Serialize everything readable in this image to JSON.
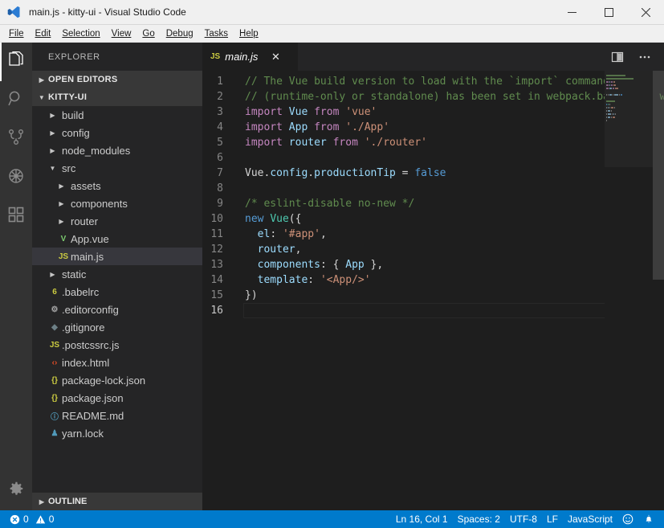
{
  "window": {
    "title": "main.js - kitty-ui - Visual Studio Code",
    "app_icon": "vscode-logo-icon",
    "controls": {
      "minimize": "minimize-icon",
      "maximize": "maximize-icon",
      "close": "close-icon"
    }
  },
  "menubar": {
    "items": [
      {
        "label": "File"
      },
      {
        "label": "Edit"
      },
      {
        "label": "Selection"
      },
      {
        "label": "View"
      },
      {
        "label": "Go"
      },
      {
        "label": "Debug"
      },
      {
        "label": "Tasks"
      },
      {
        "label": "Help"
      }
    ]
  },
  "activitybar": {
    "items": [
      {
        "name": "explorer",
        "icon": "files-icon",
        "active": true
      },
      {
        "name": "search",
        "icon": "search-icon",
        "active": false
      },
      {
        "name": "source-control",
        "icon": "source-control-icon",
        "active": false
      },
      {
        "name": "debug",
        "icon": "debug-icon",
        "active": false
      },
      {
        "name": "extensions",
        "icon": "extensions-icon",
        "active": false
      }
    ],
    "bottom": {
      "name": "manage",
      "icon": "gear-icon"
    }
  },
  "sidebar": {
    "header": "EXPLORER",
    "open_editors": {
      "label": "OPEN EDITORS",
      "expanded": false
    },
    "project": {
      "label": "KITTY-UI",
      "expanded": true
    },
    "tree": [
      {
        "label": "build",
        "depth": 1,
        "type": "folder",
        "expanded": false,
        "icon": "folder-icon",
        "color": "#c5c5c5"
      },
      {
        "label": "config",
        "depth": 1,
        "type": "folder",
        "expanded": false,
        "icon": "folder-icon",
        "color": "#c5c5c5"
      },
      {
        "label": "node_modules",
        "depth": 1,
        "type": "folder",
        "expanded": false,
        "icon": "folder-icon",
        "color": "#c5c5c5"
      },
      {
        "label": "src",
        "depth": 1,
        "type": "folder",
        "expanded": true,
        "icon": "folder-icon",
        "color": "#c5c5c5"
      },
      {
        "label": "assets",
        "depth": 2,
        "type": "folder",
        "expanded": false,
        "icon": "folder-icon",
        "color": "#c5c5c5"
      },
      {
        "label": "components",
        "depth": 2,
        "type": "folder",
        "expanded": false,
        "icon": "folder-icon",
        "color": "#c5c5c5"
      },
      {
        "label": "router",
        "depth": 2,
        "type": "folder",
        "expanded": false,
        "icon": "folder-icon",
        "color": "#c5c5c5"
      },
      {
        "label": "App.vue",
        "depth": 2,
        "type": "file",
        "icon": "vue-icon",
        "glyph": "V",
        "color": "#7bc96f"
      },
      {
        "label": "main.js",
        "depth": 2,
        "type": "file",
        "icon": "js-icon",
        "glyph": "JS",
        "color": "#cbcb41",
        "selected": true
      },
      {
        "label": "static",
        "depth": 1,
        "type": "folder",
        "expanded": false,
        "icon": "folder-icon",
        "color": "#c5c5c5"
      },
      {
        "label": ".babelrc",
        "depth": 1,
        "type": "file",
        "icon": "babel-icon",
        "glyph": "6",
        "color": "#cbcb41"
      },
      {
        "label": ".editorconfig",
        "depth": 1,
        "type": "file",
        "icon": "gear-icon",
        "glyph": "⚙",
        "color": "#a8a8a8"
      },
      {
        "label": ".gitignore",
        "depth": 1,
        "type": "file",
        "icon": "git-icon",
        "glyph": "◆",
        "color": "#6d8086"
      },
      {
        "label": ".postcssrc.js",
        "depth": 1,
        "type": "file",
        "icon": "js-icon",
        "glyph": "JS",
        "color": "#cbcb41"
      },
      {
        "label": "index.html",
        "depth": 1,
        "type": "file",
        "icon": "html-icon",
        "glyph": "‹›",
        "color": "#e44d26"
      },
      {
        "label": "package-lock.json",
        "depth": 1,
        "type": "file",
        "icon": "json-icon",
        "glyph": "{}",
        "color": "#cbcb41"
      },
      {
        "label": "package.json",
        "depth": 1,
        "type": "file",
        "icon": "json-icon",
        "glyph": "{}",
        "color": "#cbcb41"
      },
      {
        "label": "README.md",
        "depth": 1,
        "type": "file",
        "icon": "markdown-icon",
        "glyph": "ⓘ",
        "color": "#519aba"
      },
      {
        "label": "yarn.lock",
        "depth": 1,
        "type": "file",
        "icon": "yarn-icon",
        "glyph": "♟",
        "color": "#519aba"
      }
    ],
    "outline": {
      "label": "OUTLINE",
      "expanded": false
    }
  },
  "editor": {
    "tab": {
      "label": "main.js",
      "icon": "js-icon",
      "icon_glyph": "JS",
      "close_icon": "close-icon",
      "italic": true
    },
    "actions": [
      {
        "name": "split-editor",
        "icon": "split-editor-icon"
      },
      {
        "name": "more-actions",
        "icon": "ellipsis-icon"
      }
    ],
    "line_count": 16,
    "active_line": 16,
    "lines": [
      {
        "n": 1,
        "tokens": [
          {
            "t": "// The Vue build version to load with the `import` command",
            "c": "comment"
          }
        ]
      },
      {
        "n": 2,
        "tokens": [
          {
            "t": "// (runtime-only or standalone) has been set in webpack.base.conf with an alias.",
            "c": "comment"
          }
        ]
      },
      {
        "n": 3,
        "tokens": [
          {
            "t": "import ",
            "c": "kw"
          },
          {
            "t": "Vue",
            "c": "var"
          },
          {
            "t": " from ",
            "c": "kw"
          },
          {
            "t": "'vue'",
            "c": "str"
          }
        ]
      },
      {
        "n": 4,
        "tokens": [
          {
            "t": "import ",
            "c": "kw"
          },
          {
            "t": "App",
            "c": "var"
          },
          {
            "t": " from ",
            "c": "kw"
          },
          {
            "t": "'./App'",
            "c": "str"
          }
        ]
      },
      {
        "n": 5,
        "tokens": [
          {
            "t": "import ",
            "c": "kw"
          },
          {
            "t": "router",
            "c": "var"
          },
          {
            "t": " from ",
            "c": "kw"
          },
          {
            "t": "'./router'",
            "c": "str"
          }
        ]
      },
      {
        "n": 6,
        "tokens": []
      },
      {
        "n": 7,
        "tokens": [
          {
            "t": "Vue",
            "c": "plain"
          },
          {
            "t": ".",
            "c": "plain"
          },
          {
            "t": "config",
            "c": "prop"
          },
          {
            "t": ".",
            "c": "plain"
          },
          {
            "t": "productionTip",
            "c": "prop"
          },
          {
            "t": " = ",
            "c": "plain"
          },
          {
            "t": "false",
            "c": "kw2"
          }
        ]
      },
      {
        "n": 8,
        "tokens": []
      },
      {
        "n": 9,
        "tokens": [
          {
            "t": "/* eslint-disable no-new */",
            "c": "comment"
          }
        ]
      },
      {
        "n": 10,
        "tokens": [
          {
            "t": "new ",
            "c": "kw2"
          },
          {
            "t": "Vue",
            "c": "class"
          },
          {
            "t": "({",
            "c": "plain"
          }
        ]
      },
      {
        "n": 11,
        "tokens": [
          {
            "t": "  ",
            "c": "plain"
          },
          {
            "t": "el",
            "c": "var"
          },
          {
            "t": ": ",
            "c": "plain"
          },
          {
            "t": "'#app'",
            "c": "str"
          },
          {
            "t": ",",
            "c": "plain"
          }
        ]
      },
      {
        "n": 12,
        "tokens": [
          {
            "t": "  ",
            "c": "plain"
          },
          {
            "t": "router",
            "c": "var"
          },
          {
            "t": ",",
            "c": "plain"
          }
        ]
      },
      {
        "n": 13,
        "tokens": [
          {
            "t": "  ",
            "c": "plain"
          },
          {
            "t": "components",
            "c": "var"
          },
          {
            "t": ": { ",
            "c": "plain"
          },
          {
            "t": "App",
            "c": "var"
          },
          {
            "t": " },",
            "c": "plain"
          }
        ]
      },
      {
        "n": 14,
        "tokens": [
          {
            "t": "  ",
            "c": "plain"
          },
          {
            "t": "template",
            "c": "var"
          },
          {
            "t": ": ",
            "c": "plain"
          },
          {
            "t": "'<App/>'",
            "c": "str"
          }
        ]
      },
      {
        "n": 15,
        "tokens": [
          {
            "t": "})",
            "c": "plain"
          }
        ]
      },
      {
        "n": 16,
        "tokens": []
      }
    ]
  },
  "statusbar": {
    "errors": {
      "icon": "error-icon",
      "count": "0"
    },
    "warnings": {
      "icon": "warning-icon",
      "count": "0"
    },
    "position": "Ln 16, Col 1",
    "indentation": "Spaces: 2",
    "encoding": "UTF-8",
    "eol": "LF",
    "language": "JavaScript",
    "feedback_icon": "smiley-icon",
    "notifications_icon": "bell-icon",
    "background": "#007acc"
  },
  "colors": {
    "activitybar_bg": "#333333",
    "sidebar_bg": "#252526",
    "editor_bg": "#1e1e1e",
    "selection_bg": "#37373d",
    "statusbar_bg": "#007acc",
    "titlebar_bg": "#f0f0f0"
  }
}
